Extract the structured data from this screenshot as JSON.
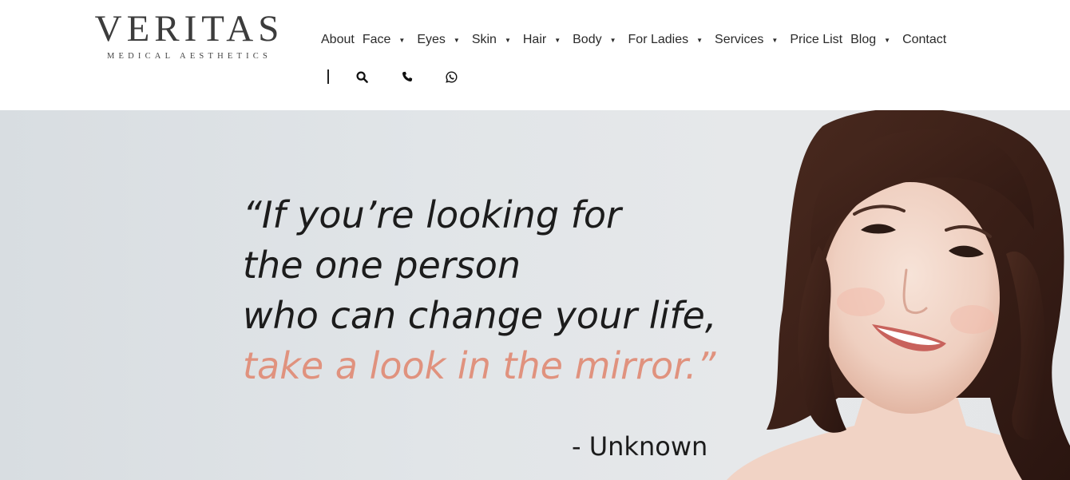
{
  "header": {
    "logo": {
      "main": "VERITAS",
      "sub": "Medical Aesthetics"
    },
    "nav": [
      {
        "label": "About",
        "dropdown": false
      },
      {
        "label": "Face",
        "dropdown": true
      },
      {
        "label": "Eyes",
        "dropdown": true
      },
      {
        "label": "Skin",
        "dropdown": true
      },
      {
        "label": "Hair",
        "dropdown": true
      },
      {
        "label": "Body",
        "dropdown": true
      },
      {
        "label": "For Ladies",
        "dropdown": true
      },
      {
        "label": "Services",
        "dropdown": true
      },
      {
        "label": "Price List",
        "dropdown": false
      },
      {
        "label": "Blog",
        "dropdown": true
      },
      {
        "label": "Contact",
        "dropdown": false
      }
    ],
    "icons": [
      "search-icon",
      "phone-icon",
      "whatsapp-icon"
    ]
  },
  "hero": {
    "quote_lines": [
      "“If you’re looking for",
      "the one person",
      "who can change your life,"
    ],
    "quote_accent": "take a look in the mirror.”",
    "author": "- Unknown"
  },
  "colors": {
    "accent": "#e0927e",
    "text": "#1c1c1c",
    "hero_bg": "#e1e5e8",
    "header_bg": "#ffffff"
  }
}
